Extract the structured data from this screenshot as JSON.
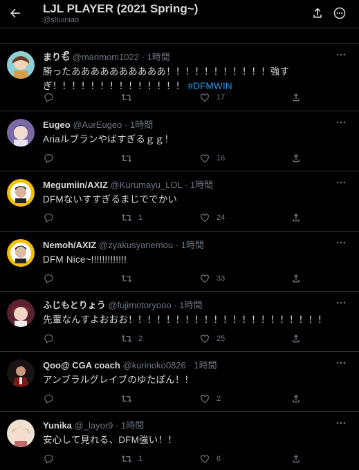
{
  "header": {
    "title": "LJL PLAYER (2021 Spring~)",
    "handle": "@shuiniao"
  },
  "tweets": [
    {
      "name": "まりもຶ",
      "user": "@marimom1022",
      "time": "1時間",
      "text": "勝ったああああああああああ！！！！！！！！！！！強すぎ！！！！！！！！！！！！！！",
      "hashtag": "#DFMWIN",
      "replies": "",
      "retweets": "",
      "likes": "17"
    },
    {
      "name": "Eugeo",
      "user": "@AurEugeo",
      "time": "1時間",
      "text": "Ariaルブランやばすぎるｇｇ！",
      "hashtag": "",
      "replies": "",
      "retweets": "",
      "likes": "16"
    },
    {
      "name": "Megumiin/AXIZ",
      "user": "@Kurumayu_LOL",
      "time": "1時間",
      "text": "DFMないすすぎるまじででかい",
      "hashtag": "",
      "replies": "",
      "retweets": "1",
      "likes": "24"
    },
    {
      "name": "Nemoh/AXIZ",
      "user": "@zyakusyanemou",
      "time": "1時間",
      "text": "DFM Nice~!!!!!!!!!!!!!",
      "hashtag": "",
      "replies": "",
      "retweets": "",
      "likes": "33"
    },
    {
      "name": "ふじもとりょう",
      "user": "@fujimotoryooo",
      "time": "1時間",
      "text": "先輩なんすよおおお！！！！！！！！！！！！！！！！！！！！！",
      "hashtag": "",
      "replies": "",
      "retweets": "2",
      "likes": "25"
    },
    {
      "name": "Qoo@ CGA coach",
      "user": "@kurinoko0826",
      "time": "1時間",
      "text": "アンブラルグレイブのゆたぽん！！",
      "hashtag": "",
      "replies": "",
      "retweets": "",
      "likes": "2"
    },
    {
      "name": "Yunika",
      "user": "@_layor9",
      "time": "1時間",
      "text": "安心して見れる、DFM強い！！",
      "hashtag": "",
      "replies": "",
      "retweets": "1",
      "likes": "6"
    }
  ],
  "colors": {
    "background": "#000000",
    "text": "#d9d9d9",
    "muted": "#6e767d",
    "link": "#1d9bf0",
    "divider": "#2f3336"
  },
  "icons": [
    "back-arrow-icon",
    "share-icon",
    "more-icon",
    "reply-icon",
    "retweet-icon",
    "like-icon"
  ]
}
